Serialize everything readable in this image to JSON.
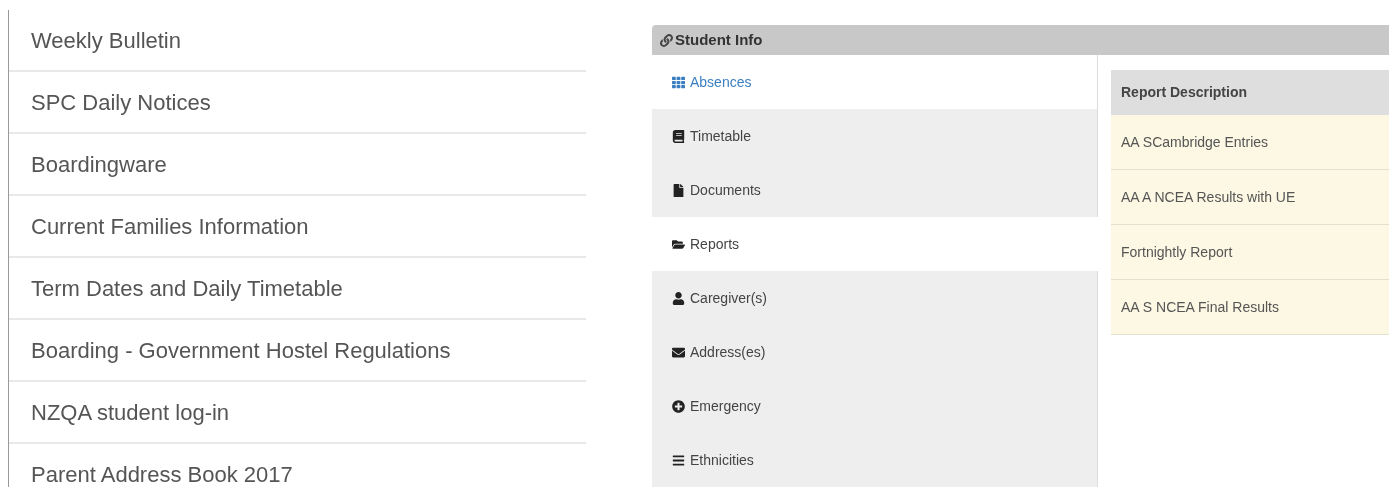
{
  "links": [
    {
      "label": "Weekly Bulletin"
    },
    {
      "label": "SPC Daily Notices"
    },
    {
      "label": "Boardingware"
    },
    {
      "label": "Current Families Information"
    },
    {
      "label": "Term Dates and Daily Timetable"
    },
    {
      "label": "Boarding - Government Hostel Regulations"
    },
    {
      "label": "NZQA student log-in"
    },
    {
      "label": "Parent Address Book 2017"
    }
  ],
  "panel": {
    "title": "Student Info",
    "tabs": [
      {
        "label": "Absences",
        "selected": false,
        "hovered": true
      },
      {
        "label": "Timetable",
        "selected": false,
        "hovered": false
      },
      {
        "label": "Documents",
        "selected": false,
        "hovered": false
      },
      {
        "label": "Reports",
        "selected": true,
        "hovered": false
      },
      {
        "label": "Caregiver(s)",
        "selected": false,
        "hovered": false
      },
      {
        "label": "Address(es)",
        "selected": false,
        "hovered": false
      },
      {
        "label": "Emergency",
        "selected": false,
        "hovered": false
      },
      {
        "label": "Ethnicities",
        "selected": false,
        "hovered": false
      }
    ],
    "table": {
      "columns": [
        "Report Description"
      ],
      "rows": [
        [
          "AA SCambridge Entries"
        ],
        [
          "AA A NCEA Results with UE"
        ],
        [
          "Fortnightly Report"
        ],
        [
          "AA S NCEA Final Results"
        ]
      ]
    }
  }
}
